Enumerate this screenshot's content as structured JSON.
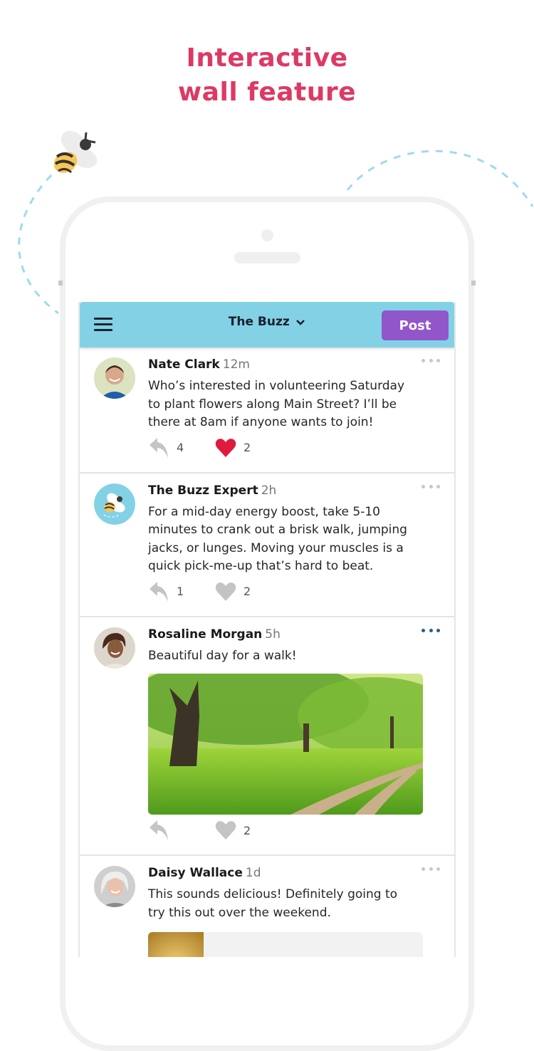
{
  "headline": {
    "line1": "Interactive",
    "line2": "wall feature",
    "color": "#dc3a64"
  },
  "app": {
    "title": "The Buzz",
    "title_icon": "chevron-down-icon",
    "menu_icon": "hamburger-menu-icon",
    "post_button": "Post",
    "header_color": "#83d1e5",
    "post_button_color": "#9256cb"
  },
  "posts": [
    {
      "author": "Nate Clark",
      "time": "12m",
      "text": "Who’s interested in volunteering Saturday to plant flowers along Main Street? I’ll be there at 8am if anyone wants to join!",
      "replies": "4",
      "likes": "2",
      "liked": true,
      "avatar": "avatar-nate-clark",
      "more_icon": "more-options-icon"
    },
    {
      "author": "The Buzz Expert",
      "time": "2h",
      "text": "For a mid-day energy boost, take 5-10 minutes to crank out a brisk walk, jumping jacks, or lunges. Moving your muscles is a quick pick-me-up that’s hard to beat.",
      "replies": "1",
      "likes": "2",
      "liked": false,
      "avatar": "bee-logo-avatar",
      "more_icon": "more-options-icon"
    },
    {
      "author": "Rosaline Morgan",
      "time": "5h",
      "text": "Beautiful day for a walk!",
      "replies": "",
      "likes": "2",
      "liked": false,
      "avatar": "avatar-rosaline-morgan",
      "image": "park-path-photo",
      "more_icon": "more-options-icon",
      "more_active": true
    },
    {
      "author": "Daisy Wallace",
      "time": "1d",
      "text": "This sounds delicious! Definitely going to try this out over the weekend.",
      "avatar": "avatar-daisy-wallace",
      "attachment": "shared-link-preview",
      "more_icon": "more-options-icon"
    }
  ],
  "colors": {
    "heart_active": "#e0193f",
    "icon_inactive": "#c4c4c4",
    "more_active": "#28607c",
    "dashed_path": "#9fdbea"
  }
}
